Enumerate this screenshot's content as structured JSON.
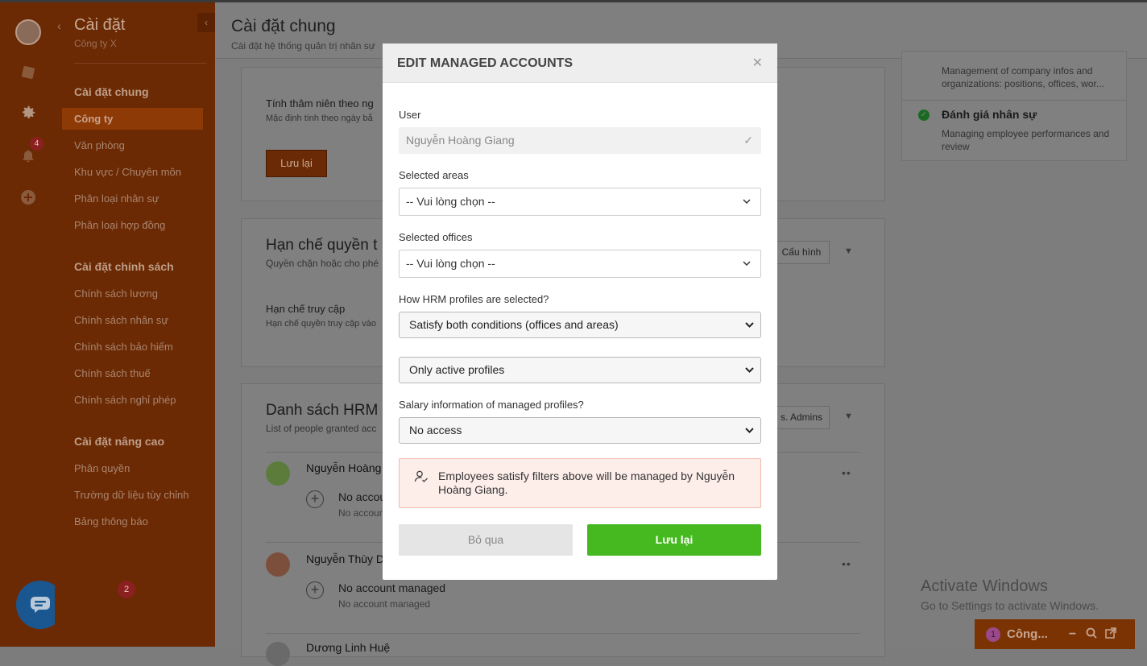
{
  "rail": {
    "notification_badge": "4",
    "task_badge": "2",
    "icons": [
      "avatar",
      "app-icon",
      "gear-icon",
      "bell-icon",
      "plus-circle-icon",
      "chat-icon",
      "clipboard-icon"
    ]
  },
  "sidebar": {
    "title": "Cài đặt",
    "subtitle": "Công ty X",
    "groups": [
      {
        "title": "Cài đặt chung",
        "items": [
          "Công ty",
          "Văn phòng",
          "Khu vực / Chuyên môn",
          "Phân loại nhân sự",
          "Phân loại hợp đồng"
        ]
      },
      {
        "title": "Cài đặt chính sách",
        "items": [
          "Chính sách lương",
          "Chính sách nhân sự",
          "Chính sách bảo hiểm",
          "Chính sách thuế",
          "Chính sách nghỉ phép"
        ]
      },
      {
        "title": "Cài đặt nâng cao",
        "items": [
          "Phân quyền",
          "Trường dữ liệu tùy chỉnh",
          "Bảng thông báo"
        ]
      }
    ],
    "active_item": "Công ty"
  },
  "main": {
    "title": "Cài đặt chung",
    "subtitle": "Cài đặt hệ thống quản trị nhân sự",
    "seniority": {
      "label": "Tính thâm niên theo ng",
      "desc": "Mặc định tính theo ngày bắ",
      "save_button": "Lưu lại"
    },
    "restrict": {
      "title": "Hạn chế quyền t",
      "desc": "Quyền chặn hoặc cho phé",
      "config_button": "Cấu hình",
      "item_label": "Hạn chế truy cập",
      "item_desc": "Hạn chế quyền truy cập vào"
    },
    "hrm": {
      "title": "Danh sách HRM",
      "desc": "List of people granted acc",
      "admins_button": "s. Admins",
      "rows": [
        {
          "name": "Nguyễn Hoàng",
          "line1": "No accou",
          "line2": "No accoun"
        },
        {
          "name": "Nguyễn Thùy D",
          "line1": "No account managed",
          "line2": "No account managed"
        },
        {
          "name": "Dương Linh Huệ",
          "line1": "",
          "line2": ""
        }
      ]
    },
    "right_card": {
      "item1_desc": "Management of company infos and organizations: positions, offices, wor...",
      "item2_title": "Đánh giá nhân sự",
      "item2_desc": "Managing employee performances and review"
    },
    "activate": {
      "line1": "Activate Windows",
      "line2": "Go to Settings to activate Windows."
    },
    "mini_bar": {
      "count": "1",
      "label": "Công..."
    }
  },
  "modal": {
    "title": "EDIT MANAGED ACCOUNTS",
    "user_label": "User",
    "user_value": "Nguyễn Hoàng Giang",
    "areas_label": "Selected areas",
    "areas_placeholder": "-- Vui lòng chọn --",
    "offices_label": "Selected offices",
    "offices_placeholder": "-- Vui lòng chọn --",
    "hrm_label": "How HRM profiles are selected?",
    "hrm_value": "Satisfy both conditions (offices and areas)",
    "profiles_value": "Only active profiles",
    "salary_label": "Salary information of managed profiles?",
    "salary_value": "No access",
    "info_text": "Employees satisfy filters above will be managed by Nguyễn Hoàng Giang.",
    "cancel_button": "Bỏ qua",
    "save_button": "Lưu lại"
  },
  "colors": {
    "accent_orange": "#e6620a",
    "save_green": "#46b820",
    "info_bg": "#fdeeea",
    "overlay": "#7d7d7d"
  }
}
